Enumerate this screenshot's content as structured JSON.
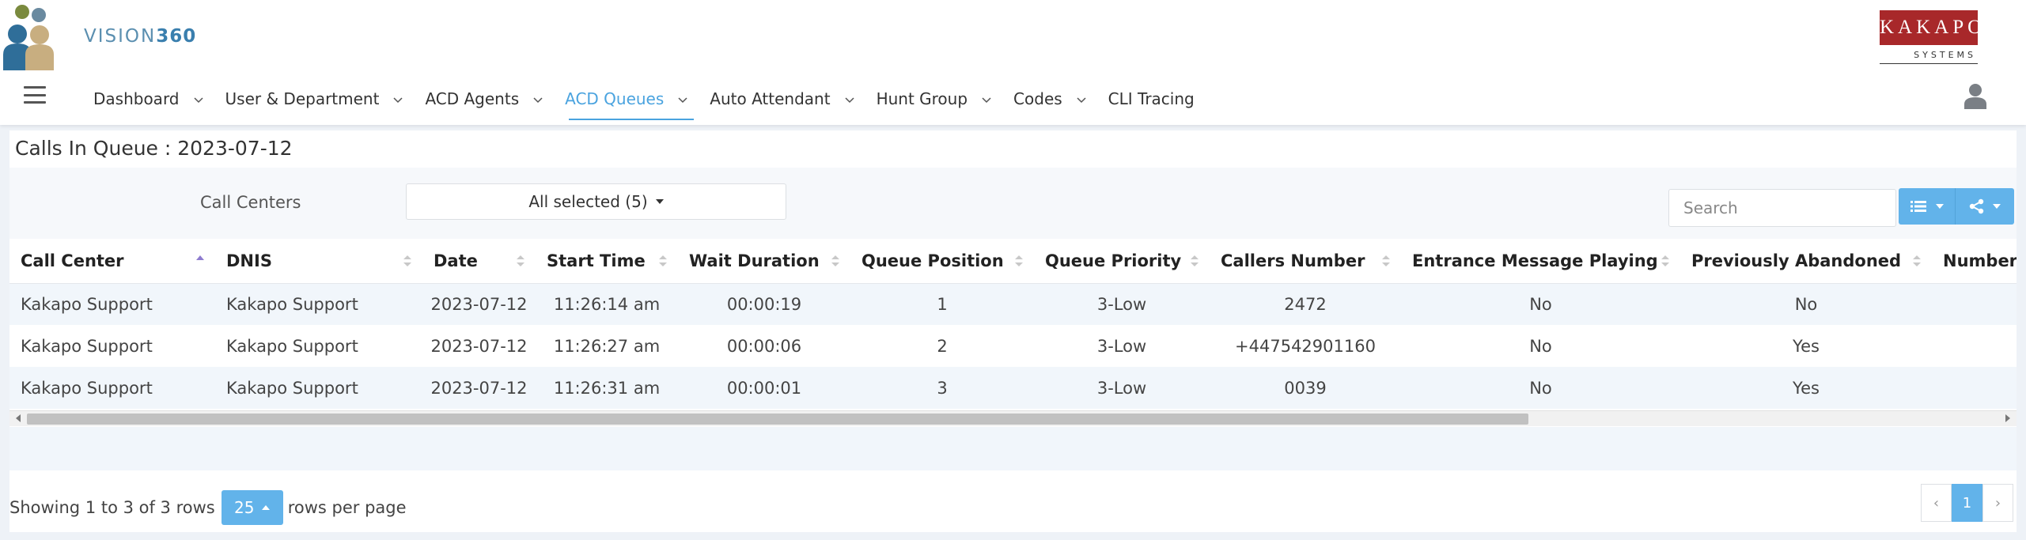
{
  "brand": {
    "app_prefix": "VISION",
    "app_suffix": "360",
    "vendor_name": "KAKAPO",
    "vendor_sub": "SYSTEMS"
  },
  "nav": {
    "items": [
      {
        "label": "Dashboard",
        "has_dropdown": true
      },
      {
        "label": "User & Department",
        "has_dropdown": true
      },
      {
        "label": "ACD Agents",
        "has_dropdown": true
      },
      {
        "label": "ACD Queues",
        "has_dropdown": true,
        "active": true
      },
      {
        "label": "Auto Attendant",
        "has_dropdown": true
      },
      {
        "label": "Hunt Group",
        "has_dropdown": true
      },
      {
        "label": "Codes",
        "has_dropdown": true
      },
      {
        "label": "CLI Tracing",
        "has_dropdown": false
      }
    ]
  },
  "page": {
    "title": "Calls In Queue : 2023-07-12"
  },
  "filters": {
    "call_centers_label": "Call Centers",
    "call_centers_value": "All selected (5)"
  },
  "search": {
    "placeholder": "Search",
    "value": ""
  },
  "table": {
    "columns": [
      "Call Center",
      "DNIS",
      "Date",
      "Start Time",
      "Wait Duration",
      "Queue Position",
      "Queue Priority",
      "Callers Number",
      "Entrance Message Playing",
      "Previously Abandoned",
      "Number of"
    ],
    "rows": [
      [
        "Kakapo Support",
        "Kakapo Support",
        "2023-07-12",
        "11:26:14 am",
        "00:00:19",
        "1",
        "3-Low",
        "2472",
        "No",
        "No",
        ""
      ],
      [
        "Kakapo Support",
        "Kakapo Support",
        "2023-07-12",
        "11:26:27 am",
        "00:00:06",
        "2",
        "3-Low",
        "+447542901160",
        "No",
        "Yes",
        ""
      ],
      [
        "Kakapo Support",
        "Kakapo Support",
        "2023-07-12",
        "11:26:31 am",
        "00:00:01",
        "3",
        "3-Low",
        "0039",
        "No",
        "Yes",
        ""
      ]
    ]
  },
  "footer": {
    "showing_text": "Showing 1 to 3 of 3 rows",
    "page_size": "25",
    "rows_per_page_text": "rows per page",
    "pager_prev": "‹",
    "pager_current": "1",
    "pager_next": "›"
  },
  "colors": {
    "accent": "#4aa3df",
    "button": "#62b3ea",
    "vendor_red": "#a8282a"
  }
}
